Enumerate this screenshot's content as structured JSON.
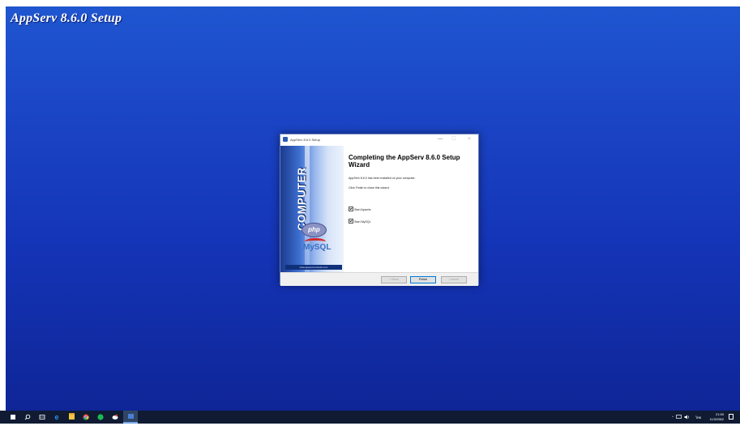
{
  "desktop": {
    "setup_title": "AppServ 8.6.0 Setup"
  },
  "window": {
    "title": "AppServ 8.6.0 Setup",
    "minimize": "—",
    "maximize": "☐",
    "close": "✕"
  },
  "banner": {
    "brand": "COMPUTER",
    "php_logo": "php",
    "mysql_logo": "MySQL",
    "url": "www.appservnetwork.com"
  },
  "content": {
    "heading": "Completing the AppServ 8.6.0 Setup Wizard",
    "installed_msg": "AppServ 8.6.0 has been installed on your computer.",
    "finish_msg": "Click Finish to close this wizard.",
    "options": [
      {
        "label": "Start Apache",
        "checked": true
      },
      {
        "label": "Start MySQL",
        "checked": true
      }
    ]
  },
  "buttons": {
    "back": "< Back",
    "finish": "Finish",
    "cancel": "Cancel"
  },
  "taskbar": {
    "apps": [
      "search-icon",
      "task-view-icon",
      "edge-icon",
      "file-explorer-icon",
      "chrome-icon",
      "spotify-icon",
      "app-icon",
      "appserv-icon"
    ],
    "tray": {
      "chevron": "^",
      "lang": "ไทย",
      "time": "21:59",
      "date": "11/3/2562"
    }
  },
  "colors": {
    "desktop_top": "#1f56d0",
    "desktop_bottom": "#0f2597",
    "taskbar": "#101b33",
    "accent": "#0078d7"
  }
}
